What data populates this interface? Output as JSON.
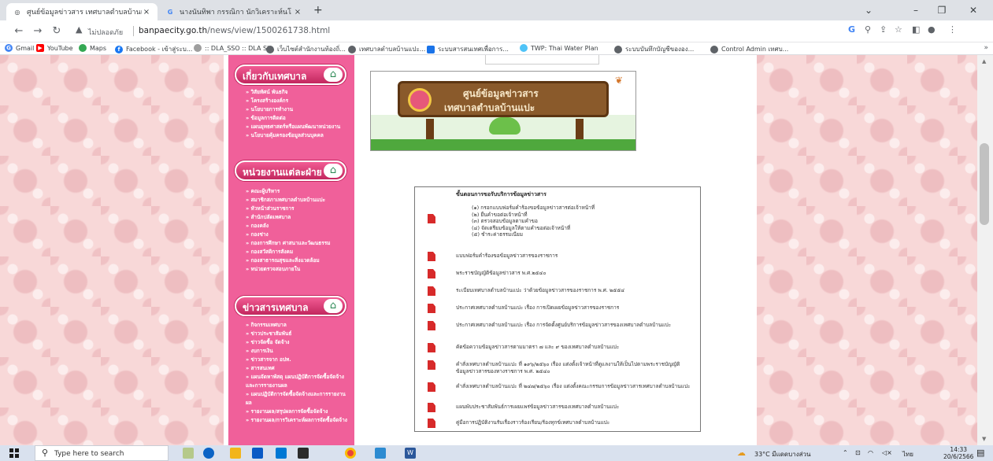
{
  "browser": {
    "tabs": [
      {
        "title": "ศูนย์ข้อมูลข่าวสาร เทศบาลตำบลบ้านแป",
        "active": true
      },
      {
        "title": "นางนันทิพา กรรณิกา นักวิเคราะห์นโ",
        "active": false
      }
    ],
    "address": {
      "insecure_label": "ไม่ปลอดภัย",
      "host": "banpaecity.go.th",
      "path": "/news/view/1500261738.html"
    },
    "bookmarks": [
      {
        "label": "Gmail",
        "icon": "gmail-icon",
        "color": "#ea4335"
      },
      {
        "label": "YouTube",
        "icon": "youtube-icon",
        "color": "#ff0000"
      },
      {
        "label": "Maps",
        "icon": "maps-icon",
        "color": "#34a853"
      },
      {
        "label": "Facebook - เข้าสู่ระบ...",
        "icon": "facebook-icon",
        "color": "#1877f2"
      },
      {
        "label": ":: DLA_SSO :: DLA Si...",
        "icon": "dla-icon",
        "color": "#7a7a7a"
      },
      {
        "label": "เว็บไซต์สำนักงานท้องถิ่...",
        "icon": "globe-icon",
        "color": "#5f6368"
      },
      {
        "label": "เทศบาลตำบลบ้านแปะ...",
        "icon": "globe-icon",
        "color": "#5f6368"
      },
      {
        "label": "ระบบสารสนเทศเพื่อการ...",
        "icon": "info-system-icon",
        "color": "#1a73e8"
      },
      {
        "label": "TWP: Thai Water Plan",
        "icon": "water-icon",
        "color": "#4fc3f7"
      },
      {
        "label": "ระบบบันทึกบัญชีขององ...",
        "icon": "globe-icon",
        "color": "#5f6368"
      },
      {
        "label": "Control Admin เทศบ...",
        "icon": "globe-icon",
        "color": "#5f6368"
      }
    ]
  },
  "sidebar": {
    "sections": [
      {
        "title": "เกี่ยวกับเทศบาล",
        "items": [
          "วิสัยทัศน์ พันธกิจ",
          "โครงสร้างองค์กร",
          "นโยบายการทำงาน",
          "ข้อมูลการติดต่อ",
          "แผนยุทธศาสตร์หรือแผนพัฒนาหน่วยงาน",
          "นโยบายคุ้มครองข้อมูลส่วนบุคคล"
        ]
      },
      {
        "title": "หน่วยงานแต่ละฝ่าย",
        "items": [
          "คณะผู้บริหาร",
          "สมาชิกสภาเทศบาลตำบลบ้านแปะ",
          "หัวหน้าส่วนราชการ",
          "สำนักปลัดเทศบาล",
          "กองคลัง",
          "กองช่าง",
          "กองการศึกษา ศาสนาและวัฒนธรรม",
          "กองสวัสดิการสังคม",
          "กองสาธารณสุขและสิ่งแวดล้อม",
          "หน่วยตรวจสอบภายใน"
        ]
      },
      {
        "title": "ข่าวสารเทศบาล",
        "items": [
          "กิจกรรมเทศบาล",
          "ข่าวประชาสัมพันธ์",
          "ข่าวจัดซื้อ จัดจ้าง",
          "งบการเงิน",
          "ข่าวสารจาก อปท.",
          "สารสนเทศ",
          "แผนจัดหาพัสดุ แผนปฏิบัติการจัดซื้อจัดจ้าง และการรายงานผล",
          "แผนปฏิบัติการจัดซื้อจัดจ้างและการรายงานผล",
          "รายงานผล/สรุปผลการจัดซื้อจัดจ้าง",
          "รายงานผล/การวิเคราะห์ผลการจัดซื้อจัดจ้าง"
        ]
      }
    ]
  },
  "banner": {
    "line1": "ศูนย์ข้อมูลข่าวสาร",
    "line2": "เทศบาลตำบลบ้านแปะ"
  },
  "documents": {
    "heading": "ขั้นตอนการขอรับบริการข้อมูลข่าวสาร",
    "steps": [
      "(๑) กรอกแบบฟอร์มคำร้องขอข้อมูลข่าวสารต่อเจ้าหน้าที่",
      "(๒) ยื่นคำขอต่อเจ้าหน้าที่",
      "(๓) ตรวจสอบข้อมูลตามคำขอ",
      "(๔) จัดเตรียมข้อมูลให้ตามคำขอต่อเจ้าหน้าที่",
      "(๕) ชำระค่าธรรมเนียม"
    ],
    "items": [
      "แบบฟอร์มคำร้องขอข้อมูลข่าวสารของราชการ",
      "พระราชบัญญัติข้อมูลข่าวสาร พ.ศ.๒๕๔๐",
      "ระเบียบเทศบาลตำบลบ้านแปะ ว่าด้วยข้อมูลข่าวสารของราชการ พ.ศ. ๒๕๕๔",
      "ประกาศเทศบาลตำบลบ้านแปะ เรื่อง การเปิดเผยข้อมูลข่าวสารของราชการ",
      "ประกาศเทศบาลตำบลบ้านแปะ เรื่อง การจัดตั้งศูนย์บริการข้อมูลข่าวสารของเทศบาลตำบลบ้านแปะ",
      "คัดข้อความข้อมูลข่าวสารตามมาตรา ๗ และ ๙ ของเทศบาลตำบลบ้านแปะ",
      "คำสั่งเทศบาลตำบลบ้านแปะ ที่ ๑๙๖/๒๕๖๐ เรื่อง แต่งตั้งเจ้าหน้าที่ดูแลงานให้เป็นไปตามพระราชบัญญัติข้อมูลข่าวสารของทางราชการ พ.ศ. ๒๕๔๐",
      "คำสั่งเทศบาลตำบลบ้านแปะ ที่ ๒๔๗/๒๕๖๐ เรื่อง แต่งตั้งคณะกรรมการข้อมูลข่าวสารเทศบาลตำบลบ้านแปะ",
      "แผนพับประชาสัมพันธ์การเผยแพร่ข้อมูลข่าวสารของเทศบาลตำบลบ้านแปะ",
      "คู่มือการปฏิบัติงานรับเรื่องราวร้องเรียน/ร้องทุกข์เทศบาลตำบลบ้านแปะ"
    ]
  },
  "taskbar": {
    "search_placeholder": "Type here to search",
    "weather": "33°C มีแดดบางส่วน",
    "lang": "ไทย",
    "time": "14:33",
    "date": "20/6/2566"
  }
}
